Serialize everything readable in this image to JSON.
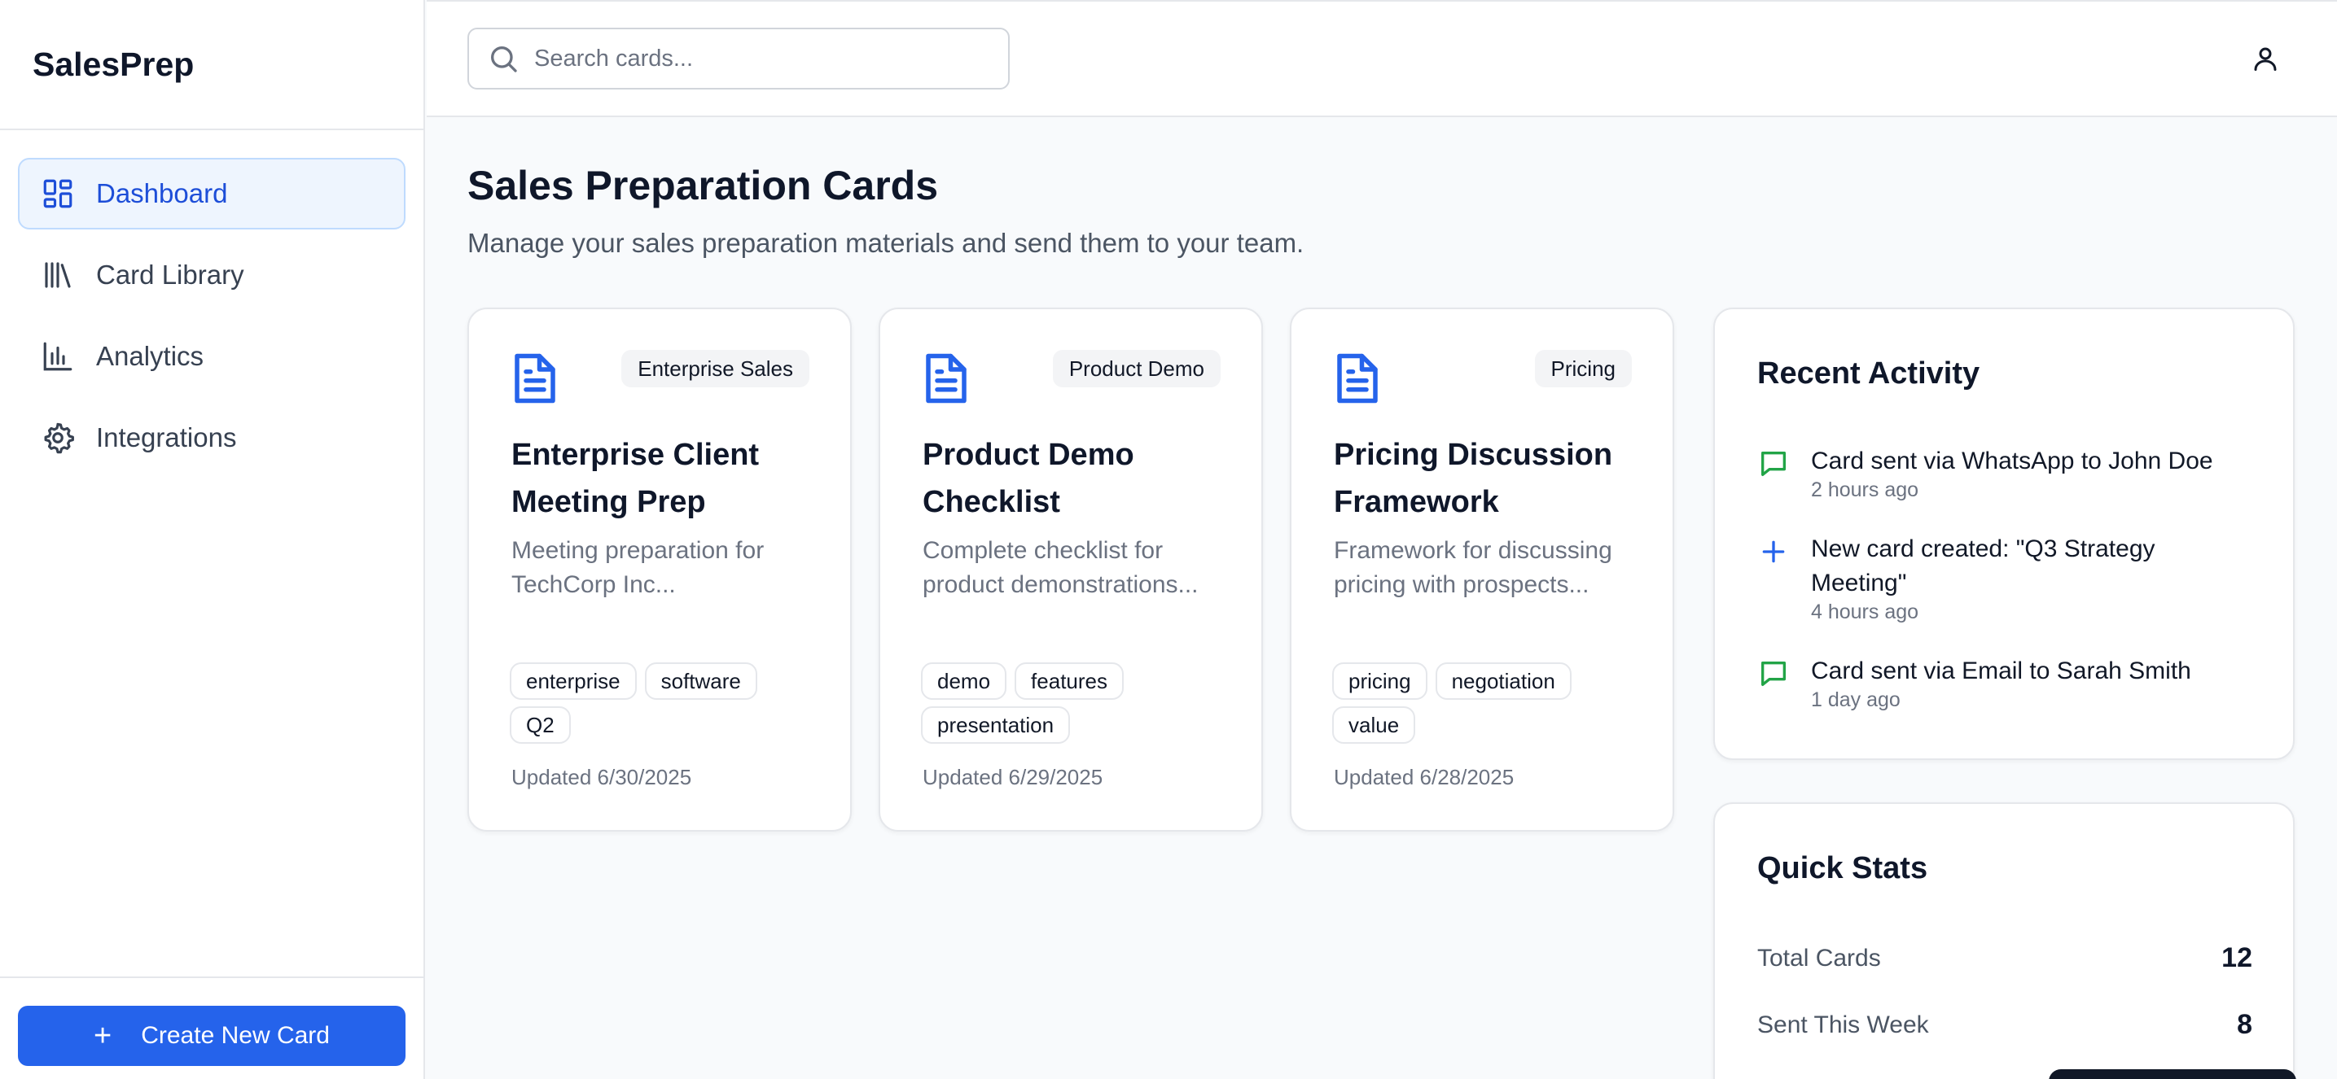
{
  "app": {
    "name": "SalesPrep"
  },
  "sidebar": {
    "items": [
      {
        "label": "Dashboard",
        "icon": "dashboard-icon",
        "active": true
      },
      {
        "label": "Card Library",
        "icon": "library-icon",
        "active": false
      },
      {
        "label": "Analytics",
        "icon": "bar-chart-icon",
        "active": false
      },
      {
        "label": "Integrations",
        "icon": "gear-icon",
        "active": false
      }
    ],
    "create_button": "Create New Card"
  },
  "header": {
    "search": {
      "placeholder": "Search cards...",
      "value": ""
    },
    "user_icon": "user-icon"
  },
  "main": {
    "title": "Sales Preparation Cards",
    "subtitle": "Manage your sales preparation materials and send them to your team.",
    "cards": [
      {
        "category": "Enterprise Sales",
        "title": "Enterprise Client Meeting Prep",
        "description": "Meeting preparation for TechCorp Inc...",
        "tags": [
          "enterprise",
          "software",
          "Q2"
        ],
        "updated": "Updated 6/30/2025"
      },
      {
        "category": "Product Demo",
        "title": "Product Demo Checklist",
        "description": "Complete checklist for product demonstrations...",
        "tags": [
          "demo",
          "features",
          "presentation"
        ],
        "updated": "Updated 6/29/2025"
      },
      {
        "category": "Pricing",
        "title": "Pricing Discussion Framework",
        "description": "Framework for discussing pricing with prospects...",
        "tags": [
          "pricing",
          "negotiation",
          "value"
        ],
        "updated": "Updated 6/28/2025"
      }
    ]
  },
  "activity": {
    "title": "Recent Activity",
    "items": [
      {
        "icon": "message-icon",
        "text": "Card sent via WhatsApp to John Doe",
        "time": "2 hours ago"
      },
      {
        "icon": "plus-icon",
        "text": "New card created: \"Q3 Strategy Meeting\"",
        "time": "4 hours ago"
      },
      {
        "icon": "message-icon",
        "text": "Card sent via Email to Sarah Smith",
        "time": "1 day ago"
      }
    ]
  },
  "stats": {
    "title": "Quick Stats",
    "rows": [
      {
        "label": "Total Cards",
        "value": "12"
      },
      {
        "label": "Sent This Week",
        "value": "8"
      }
    ]
  },
  "colors": {
    "accent": "#2563eb",
    "active_bg": "#eef5fe",
    "success": "#22a447"
  }
}
